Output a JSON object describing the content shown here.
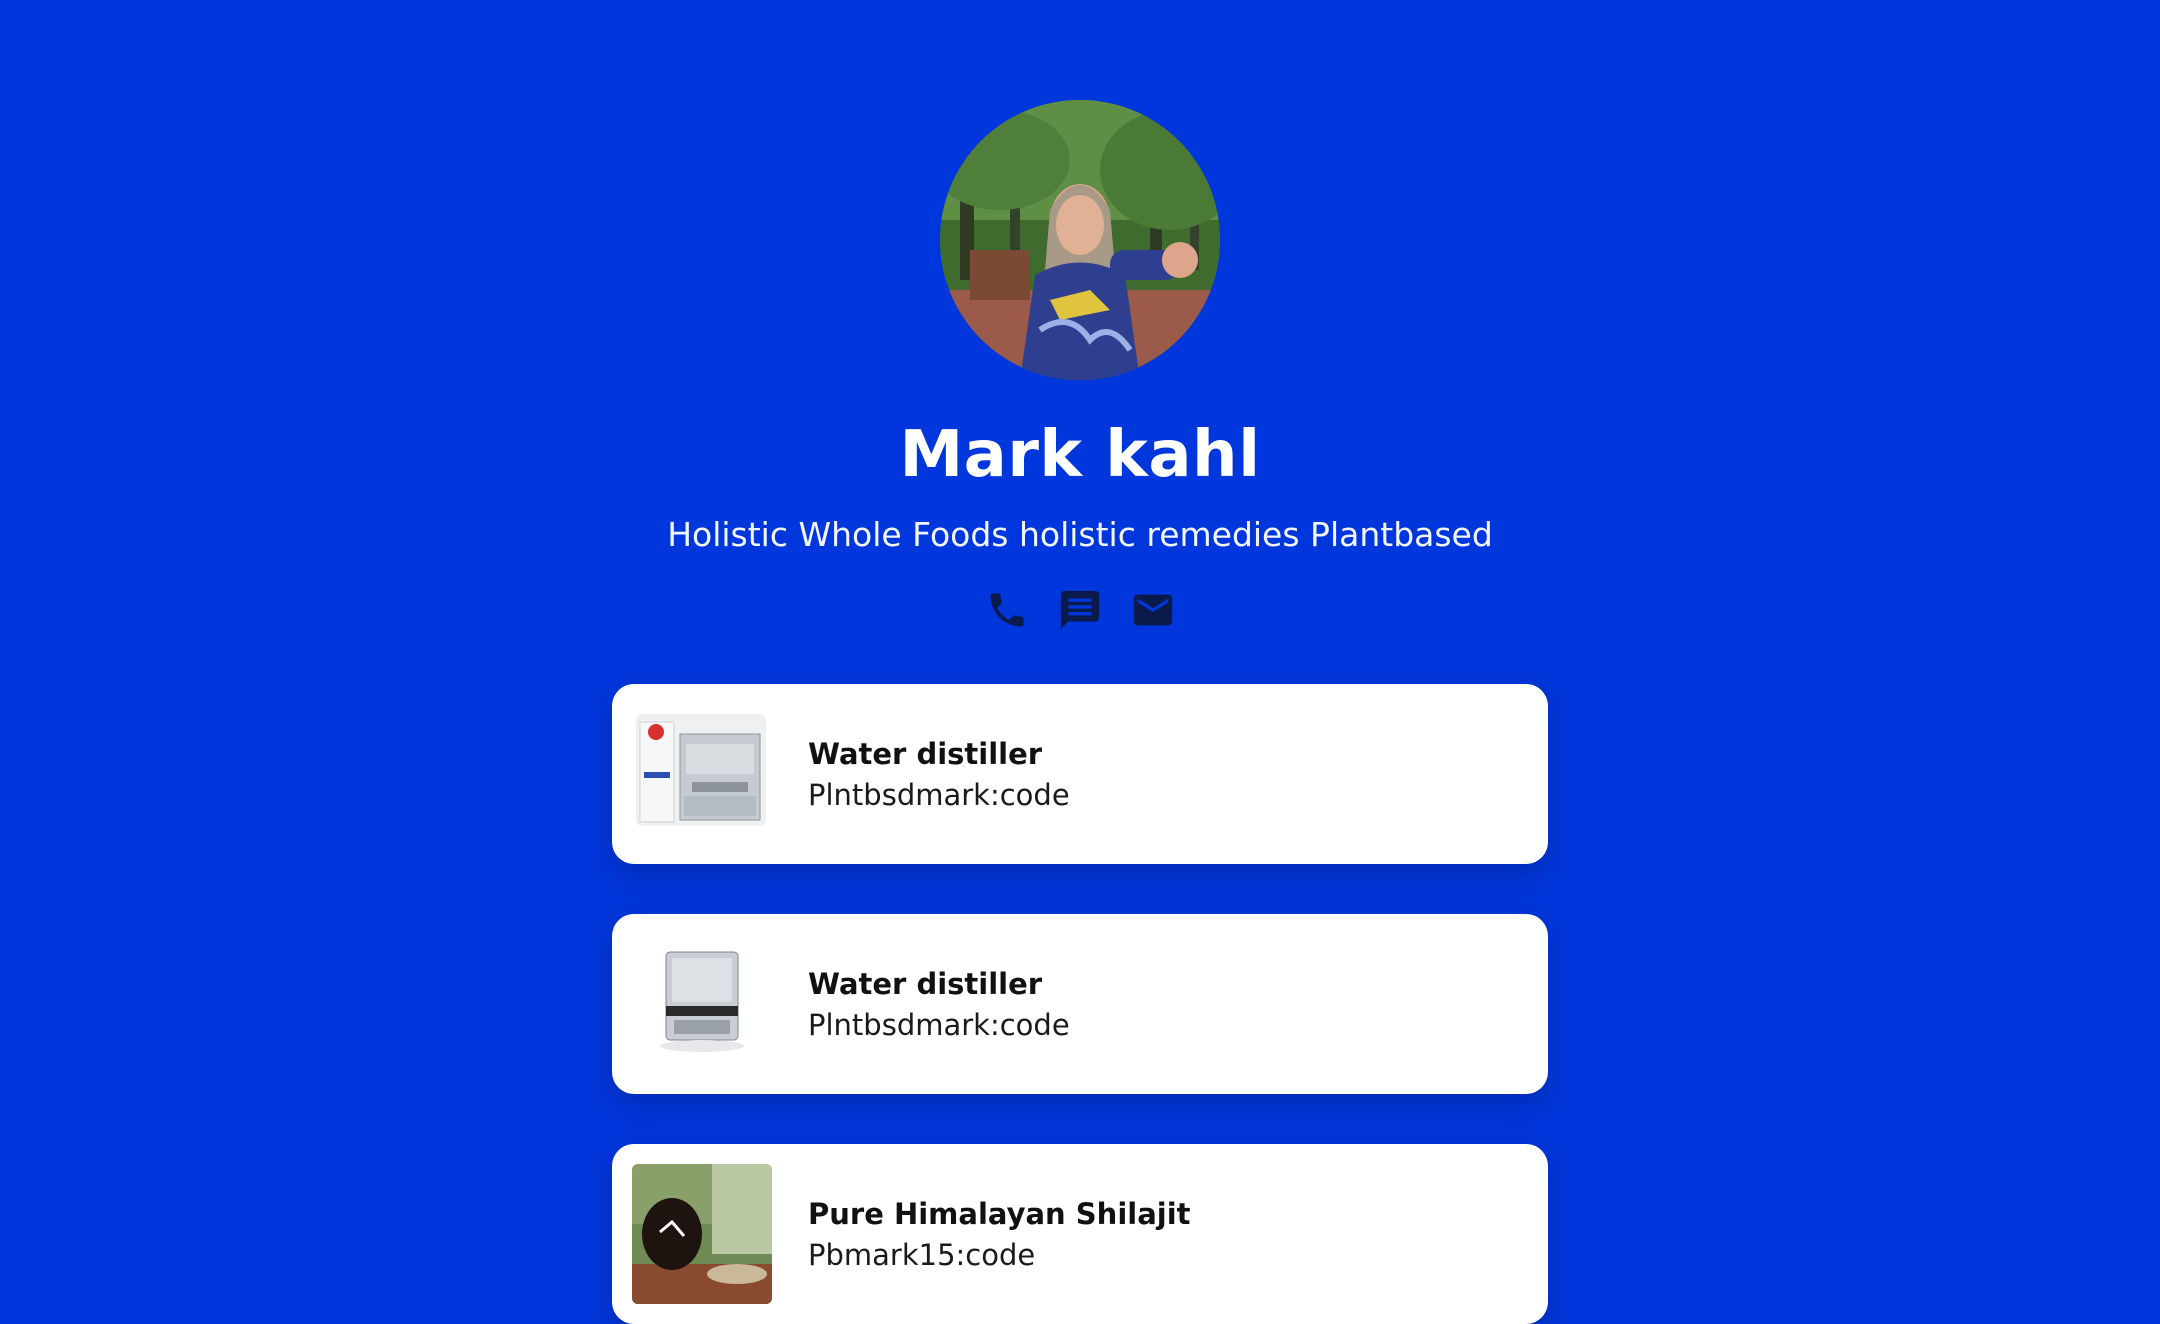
{
  "profile": {
    "name": "Mark kahl",
    "bio": "Holistic Whole Foods holistic remedies Plantbased",
    "avatar_icon": "avatar-photo"
  },
  "contacts": [
    {
      "icon": "phone-icon"
    },
    {
      "icon": "sms-icon"
    },
    {
      "icon": "email-icon"
    }
  ],
  "links": [
    {
      "title": "Water distiller",
      "subtitle": "Plntbsdmark:code",
      "thumb": "water-distiller-box"
    },
    {
      "title": "Water distiller",
      "subtitle": "Plntbsdmark:code",
      "thumb": "water-distiller-unit"
    },
    {
      "title": "Pure Himalayan Shilajit",
      "subtitle": "Pbmark15:code",
      "thumb": "shilajit-jar"
    }
  ],
  "colors": {
    "background": "#0037DD",
    "card": "#FFFFFF",
    "icon": "#0A1A4A",
    "text_primary": "#111111"
  }
}
